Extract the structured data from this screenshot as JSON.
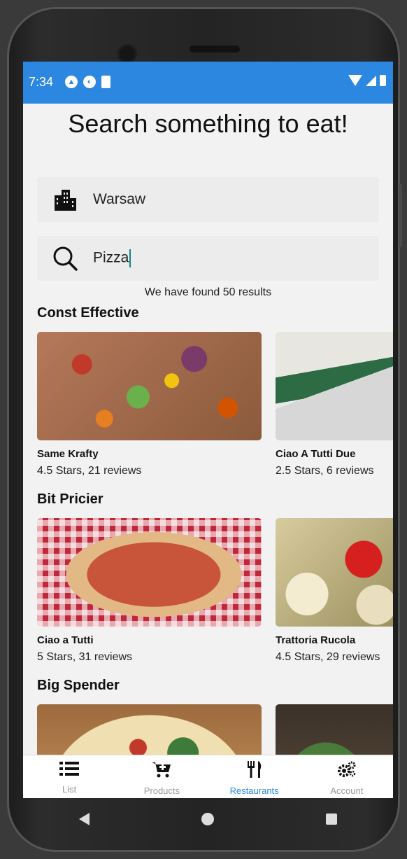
{
  "status": {
    "time": "7:34"
  },
  "page": {
    "title": "Search something to eat!"
  },
  "location": {
    "value": "Warsaw"
  },
  "search": {
    "value": "Pizza"
  },
  "results_text": "We have found 50 results",
  "sections": [
    {
      "title": "Const Effective",
      "items": [
        {
          "name": "Same Krafty",
          "meta": "4.5 Stars, 21 reviews"
        },
        {
          "name": "Ciao A Tutti Due",
          "meta": "2.5 Stars, 6 reviews"
        }
      ]
    },
    {
      "title": "Bit Pricier",
      "items": [
        {
          "name": "Ciao a Tutti",
          "meta": "5 Stars, 31 reviews"
        },
        {
          "name": "Trattoria Rucola",
          "meta": "4.5 Stars, 29 reviews"
        }
      ]
    },
    {
      "title": "Big Spender",
      "items": []
    }
  ],
  "tabs": [
    {
      "label": "List",
      "icon": "list-icon"
    },
    {
      "label": "Products",
      "icon": "cart-icon"
    },
    {
      "label": "Restaurants",
      "icon": "utensils-icon"
    },
    {
      "label": "Account",
      "icon": "gears-icon"
    }
  ],
  "colors": {
    "accent": "#2b87df"
  }
}
